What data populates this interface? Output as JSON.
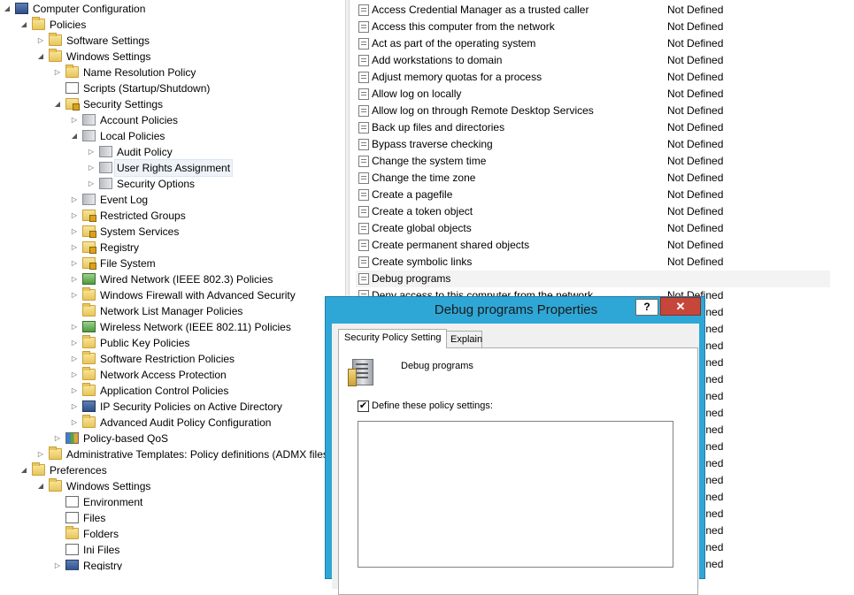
{
  "tree": [
    {
      "label": "Computer Configuration",
      "depth": 0,
      "arrow": "expanded",
      "icon": "computer-icon",
      "iconClass": "computer"
    },
    {
      "label": "Policies",
      "depth": 1,
      "arrow": "expanded",
      "icon": "folder-icon",
      "iconClass": "folder"
    },
    {
      "label": "Software Settings",
      "depth": 2,
      "arrow": "collapsed",
      "icon": "folder-icon",
      "iconClass": "folder"
    },
    {
      "label": "Windows Settings",
      "depth": 2,
      "arrow": "expanded",
      "icon": "folder-icon",
      "iconClass": "folder"
    },
    {
      "label": "Name Resolution Policy",
      "depth": 3,
      "arrow": "collapsed",
      "icon": "folder-icon",
      "iconClass": "folder"
    },
    {
      "label": "Scripts (Startup/Shutdown)",
      "depth": 3,
      "arrow": "none",
      "icon": "script-icon",
      "iconClass": "docicon"
    },
    {
      "label": "Security Settings",
      "depth": 3,
      "arrow": "expanded",
      "icon": "security-settings-icon",
      "iconClass": "lockfolder"
    },
    {
      "label": "Account Policies",
      "depth": 4,
      "arrow": "collapsed",
      "icon": "policy-icon",
      "iconClass": "policy"
    },
    {
      "label": "Local Policies",
      "depth": 4,
      "arrow": "expanded",
      "icon": "policy-icon",
      "iconClass": "policy"
    },
    {
      "label": "Audit Policy",
      "depth": 5,
      "arrow": "collapsed",
      "icon": "policy-icon",
      "iconClass": "policy"
    },
    {
      "label": "User Rights Assignment",
      "depth": 5,
      "arrow": "collapsed",
      "icon": "policy-icon",
      "iconClass": "policy",
      "selected": true
    },
    {
      "label": "Security Options",
      "depth": 5,
      "arrow": "collapsed",
      "icon": "policy-icon",
      "iconClass": "policy"
    },
    {
      "label": "Event Log",
      "depth": 4,
      "arrow": "collapsed",
      "icon": "policy-icon",
      "iconClass": "policy"
    },
    {
      "label": "Restricted Groups",
      "depth": 4,
      "arrow": "collapsed",
      "icon": "locked-folder-icon",
      "iconClass": "lockfolder"
    },
    {
      "label": "System Services",
      "depth": 4,
      "arrow": "collapsed",
      "icon": "locked-folder-icon",
      "iconClass": "lockfolder"
    },
    {
      "label": "Registry",
      "depth": 4,
      "arrow": "collapsed",
      "icon": "locked-folder-icon",
      "iconClass": "lockfolder"
    },
    {
      "label": "File System",
      "depth": 4,
      "arrow": "collapsed",
      "icon": "locked-folder-icon",
      "iconClass": "lockfolder"
    },
    {
      "label": "Wired Network (IEEE 802.3) Policies",
      "depth": 4,
      "arrow": "collapsed",
      "icon": "network-icon",
      "iconClass": "net"
    },
    {
      "label": "Windows Firewall with Advanced Security",
      "depth": 4,
      "arrow": "collapsed",
      "icon": "folder-icon",
      "iconClass": "folder"
    },
    {
      "label": "Network List Manager Policies",
      "depth": 4,
      "arrow": "none",
      "icon": "folder-icon",
      "iconClass": "folder"
    },
    {
      "label": "Wireless Network (IEEE 802.11) Policies",
      "depth": 4,
      "arrow": "collapsed",
      "icon": "network-icon",
      "iconClass": "net"
    },
    {
      "label": "Public Key Policies",
      "depth": 4,
      "arrow": "collapsed",
      "icon": "folder-icon",
      "iconClass": "folder"
    },
    {
      "label": "Software Restriction Policies",
      "depth": 4,
      "arrow": "collapsed",
      "icon": "folder-icon",
      "iconClass": "folder"
    },
    {
      "label": "Network Access Protection",
      "depth": 4,
      "arrow": "collapsed",
      "icon": "folder-icon",
      "iconClass": "folder"
    },
    {
      "label": "Application Control Policies",
      "depth": 4,
      "arrow": "collapsed",
      "icon": "folder-icon",
      "iconClass": "folder"
    },
    {
      "label": "IP Security Policies on Active Directory",
      "depth": 4,
      "arrow": "collapsed",
      "icon": "ipsec-icon",
      "iconClass": "computer"
    },
    {
      "label": "Advanced Audit Policy Configuration",
      "depth": 4,
      "arrow": "collapsed",
      "icon": "folder-icon",
      "iconClass": "folder"
    },
    {
      "label": "Policy-based QoS",
      "depth": 3,
      "arrow": "collapsed",
      "icon": "qos-chart-icon",
      "iconClass": "chart"
    },
    {
      "label": "Administrative Templates: Policy definitions (ADMX files",
      "depth": 2,
      "arrow": "collapsed",
      "icon": "folder-icon",
      "iconClass": "folder"
    },
    {
      "label": "Preferences",
      "depth": 1,
      "arrow": "expanded",
      "icon": "folder-icon",
      "iconClass": "folder"
    },
    {
      "label": "Windows Settings",
      "depth": 2,
      "arrow": "expanded",
      "icon": "folder-icon",
      "iconClass": "folder"
    },
    {
      "label": "Environment",
      "depth": 3,
      "arrow": "none",
      "icon": "environment-icon",
      "iconClass": "docicon"
    },
    {
      "label": "Files",
      "depth": 3,
      "arrow": "none",
      "icon": "files-icon",
      "iconClass": "docicon"
    },
    {
      "label": "Folders",
      "depth": 3,
      "arrow": "none",
      "icon": "folders-icon",
      "iconClass": "folder"
    },
    {
      "label": "Ini Files",
      "depth": 3,
      "arrow": "none",
      "icon": "ini-file-icon",
      "iconClass": "docicon"
    },
    {
      "label": "Registry",
      "depth": 3,
      "arrow": "collapsed",
      "icon": "registry-icon",
      "iconClass": "computer"
    }
  ],
  "policies": [
    {
      "name": "Access Credential Manager as a trusted caller",
      "setting": "Not Defined"
    },
    {
      "name": "Access this computer from the network",
      "setting": "Not Defined"
    },
    {
      "name": "Act as part of the operating system",
      "setting": "Not Defined"
    },
    {
      "name": "Add workstations to domain",
      "setting": "Not Defined"
    },
    {
      "name": "Adjust memory quotas for a process",
      "setting": "Not Defined"
    },
    {
      "name": "Allow log on locally",
      "setting": "Not Defined"
    },
    {
      "name": "Allow log on through Remote Desktop Services",
      "setting": "Not Defined"
    },
    {
      "name": "Back up files and directories",
      "setting": "Not Defined"
    },
    {
      "name": "Bypass traverse checking",
      "setting": "Not Defined"
    },
    {
      "name": "Change the system time",
      "setting": "Not Defined"
    },
    {
      "name": "Change the time zone",
      "setting": "Not Defined"
    },
    {
      "name": "Create a pagefile",
      "setting": "Not Defined"
    },
    {
      "name": "Create a token object",
      "setting": "Not Defined"
    },
    {
      "name": "Create global objects",
      "setting": "Not Defined"
    },
    {
      "name": "Create permanent shared objects",
      "setting": "Not Defined"
    },
    {
      "name": "Create symbolic links",
      "setting": "Not Defined"
    },
    {
      "name": "Debug programs",
      "setting": "",
      "selected": true
    },
    {
      "name": "Deny access to this computer from the network",
      "setting": "Not Defined"
    },
    {
      "name": "",
      "setting": "Not Defined"
    },
    {
      "name": "",
      "setting": "Not Defined"
    },
    {
      "name": "",
      "setting": "Not Defined"
    },
    {
      "name": "",
      "setting": "Not Defined"
    },
    {
      "name": "",
      "setting": "Not Defined"
    },
    {
      "name": "",
      "setting": "Not Defined"
    },
    {
      "name": "",
      "setting": "Not Defined"
    },
    {
      "name": "",
      "setting": "Not Defined"
    },
    {
      "name": "",
      "setting": "Not Defined"
    },
    {
      "name": "",
      "setting": "Not Defined"
    },
    {
      "name": "",
      "setting": "Not Defined"
    },
    {
      "name": "",
      "setting": "Not Defined"
    },
    {
      "name": "",
      "setting": "Not Defined"
    },
    {
      "name": "",
      "setting": "Not Defined"
    },
    {
      "name": "",
      "setting": "Not Defined"
    },
    {
      "name": "",
      "setting": "Not Defined"
    }
  ],
  "dialog": {
    "title": "Debug programs Properties",
    "help_label": "?",
    "close_label": "✕",
    "tabs": {
      "security_policy_setting": "Security Policy Setting",
      "explain": "Explain"
    },
    "policy_name": "Debug programs",
    "define_checked": true,
    "define_check_glyph": "✔",
    "define_label": "Define these policy settings:"
  }
}
